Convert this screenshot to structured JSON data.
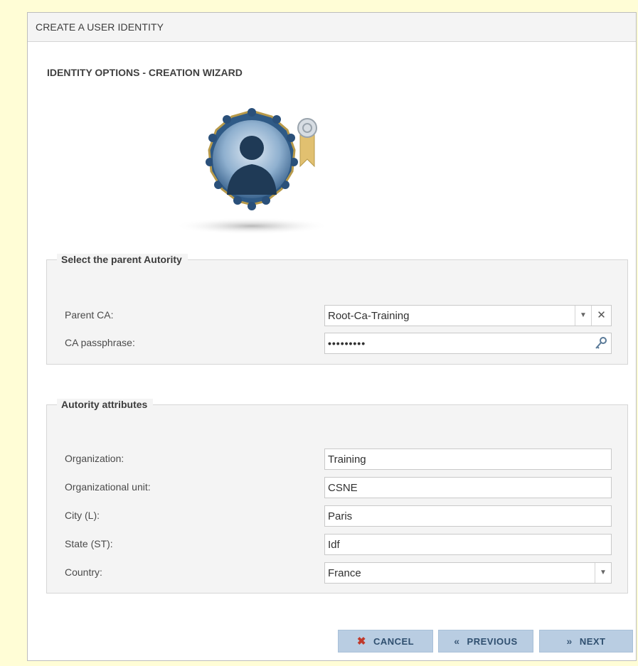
{
  "window": {
    "title": "CREATE A USER IDENTITY"
  },
  "wizard": {
    "heading": "IDENTITY OPTIONS - CREATION WIZARD",
    "icon": "user-certificate-icon"
  },
  "parent_authority": {
    "legend": "Select the parent Autority",
    "parent_ca_label": "Parent CA:",
    "parent_ca_value": "Root-Ca-Training",
    "passphrase_label": "CA passphrase:",
    "passphrase_value": "•••••••••"
  },
  "attributes": {
    "legend": "Autority attributes",
    "fields": [
      {
        "label": "Organization:",
        "value": "Training"
      },
      {
        "label": "Organizational unit:",
        "value": "CSNE"
      },
      {
        "label": "City (L):",
        "value": "Paris"
      },
      {
        "label": "State (ST):",
        "value": "Idf"
      },
      {
        "label": "Country:",
        "value": "France"
      }
    ]
  },
  "buttons": {
    "cancel": {
      "icon": "✖",
      "label": "CANCEL"
    },
    "previous": {
      "icon": "«",
      "label": "PREVIOUS"
    },
    "next": {
      "icon": "»",
      "label": "NEXT"
    }
  },
  "colors": {
    "page_bg": "#fffdd6",
    "button_bg": "#b9cde2",
    "cancel_icon": "#c0392b"
  }
}
